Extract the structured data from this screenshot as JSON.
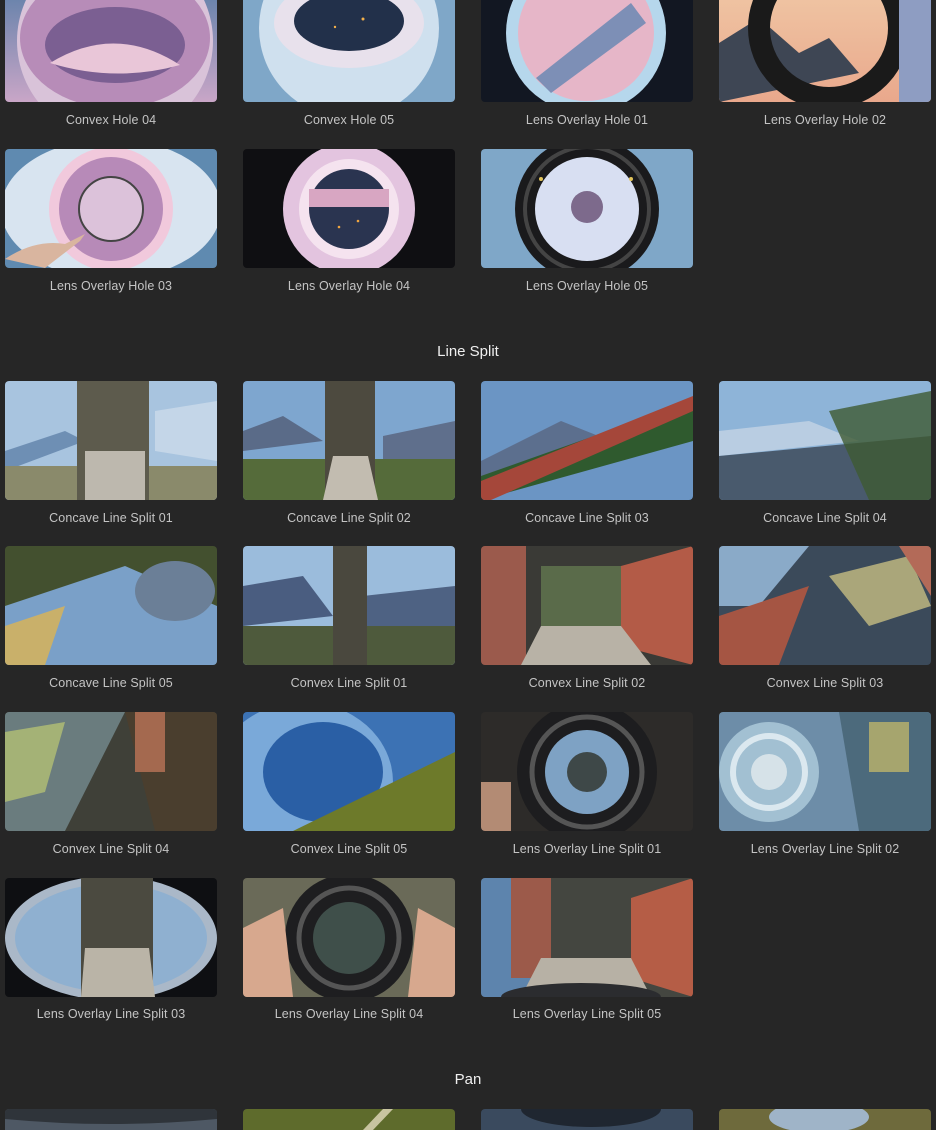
{
  "sections": [
    {
      "title": "",
      "items": [
        "Convex Hole 04",
        "Convex Hole 05",
        "Lens Overlay Hole 01",
        "Lens Overlay Hole 02",
        "Lens Overlay Hole 03",
        "Lens Overlay Hole 04",
        "Lens Overlay Hole 05"
      ]
    },
    {
      "title": "Line Split",
      "items": [
        "Concave Line Split 01",
        "Concave Line Split 02",
        "Concave Line Split 03",
        "Concave Line Split 04",
        "Concave Line Split 05",
        "Convex Line Split 01",
        "Convex Line Split 02",
        "Convex Line Split 03",
        "Convex Line Split 04",
        "Convex Line Split 05",
        "Lens Overlay Line Split 01",
        "Lens Overlay Line Split 02",
        "Lens Overlay Line Split 03",
        "Lens Overlay Line Split 04",
        "Lens Overlay Line Split 05"
      ]
    },
    {
      "title": "Pan",
      "items": []
    }
  ],
  "colors": {
    "background": "#262626",
    "label": "#c4c4c4",
    "heading": "#efefef"
  }
}
